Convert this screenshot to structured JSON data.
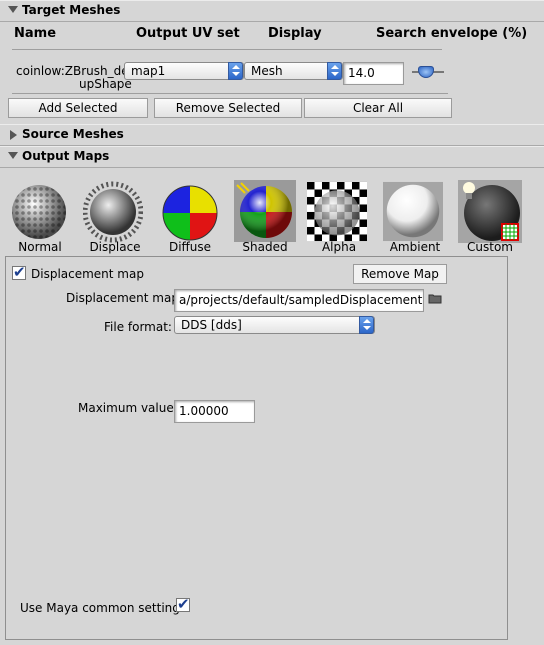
{
  "target_meshes": {
    "title": "Target Meshes",
    "columns": [
      "Name",
      "Output UV set",
      "Display",
      "Search envelope (%)"
    ],
    "row": {
      "name_line1": "coinlow:ZBrush_defu",
      "name_line2": "upShape",
      "uv_set": "map1",
      "display": "Mesh",
      "envelope": "14.0"
    },
    "buttons": {
      "add": "Add Selected",
      "remove": "Remove Selected",
      "clear": "Clear All"
    }
  },
  "source_meshes": {
    "title": "Source Meshes"
  },
  "output_maps": {
    "title": "Output Maps",
    "map_types": [
      "Normal",
      "Displace",
      "Diffuse",
      "Shaded",
      "Alpha",
      "Ambient",
      "Custom"
    ],
    "displacement": {
      "checkbox_label": "Displacement map",
      "remove_button": "Remove Map",
      "path_label": "Displacement map",
      "path_value": "a/projects/default/sampledDisplacement.dds",
      "format_label": "File format:",
      "format_value": "DDS [dds]",
      "max_label": "Maximum value:",
      "max_value": "1.00000",
      "common_label": "Use Maya common settings"
    }
  }
}
